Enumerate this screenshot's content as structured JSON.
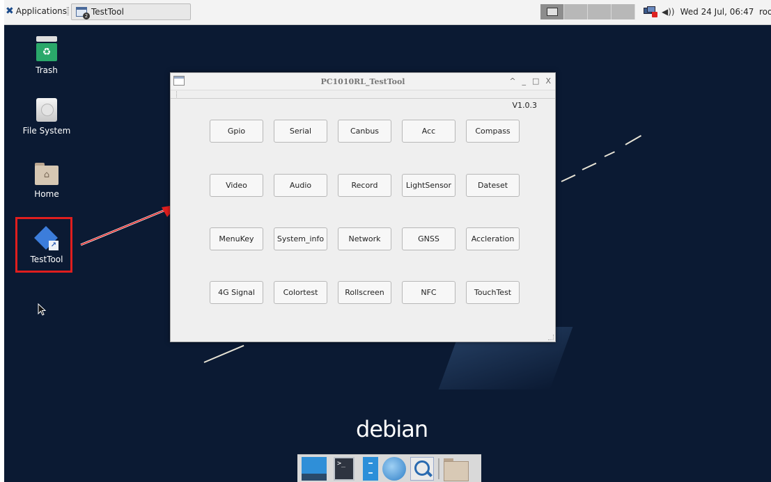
{
  "top_panel": {
    "applications_label": "Applications",
    "task_button_label": "TestTool",
    "task_badge": "2",
    "clock": "Wed 24 Jul, 06:47",
    "user": "root",
    "volume_icon": "volume-icon",
    "network_icon": "network-error-icon"
  },
  "desktop": {
    "icons": [
      {
        "label": "Trash",
        "icon": "trash-icon"
      },
      {
        "label": "File System",
        "icon": "drive-icon"
      },
      {
        "label": "Home",
        "icon": "home-folder-icon"
      },
      {
        "label": "TestTool",
        "icon": "testtool-app-icon"
      }
    ],
    "wallpaper_text": "debian",
    "highlight_color": "#e01e1e"
  },
  "window": {
    "title": "PC1010RL_TestTool",
    "version": "V1.0.3",
    "controls": [
      "^",
      "_",
      "□",
      "X"
    ],
    "buttons": [
      [
        "Gpio",
        "Serial",
        "Canbus",
        "Acc",
        "Compass"
      ],
      [
        "Video",
        "Audio",
        "Record",
        "LightSensor",
        "Dateset"
      ],
      [
        "MenuKey",
        "System_info",
        "Network",
        "GNSS",
        "Accleration"
      ],
      [
        "4G Signal",
        "Colortest",
        "Rollscreen",
        "NFC",
        "TouchTest"
      ]
    ]
  },
  "dock": {
    "items": [
      "show-desktop-icon",
      "terminal-icon",
      "file-manager-icon",
      "web-browser-icon",
      "app-finder-icon",
      "folder-icon"
    ],
    "terminal_glyph": ">_"
  }
}
